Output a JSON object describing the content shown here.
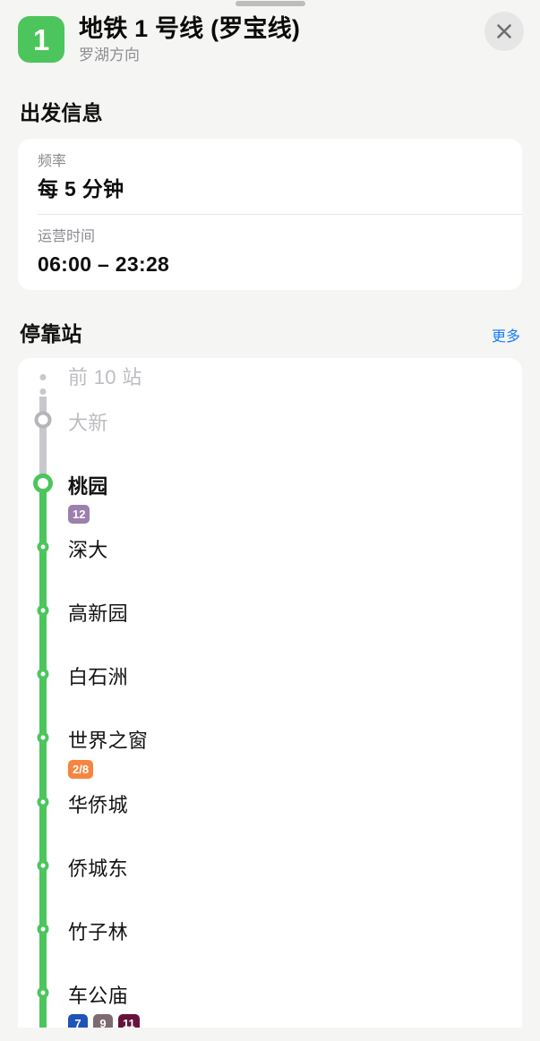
{
  "window": {
    "grabber": "drag-handle"
  },
  "header": {
    "line_number": "1",
    "line_color": "#4cc65c",
    "title": "地铁 1 号线 (罗宝线)",
    "direction": "罗湖方向",
    "close_label": "关闭"
  },
  "departure_section": {
    "title": "出发信息",
    "rows": [
      {
        "label": "频率",
        "value": "每 5 分钟"
      },
      {
        "label": "运营时间",
        "value": "06:00 – 23:28"
      }
    ]
  },
  "stops_section": {
    "title": "停靠站",
    "more_label": "更多",
    "collapsed_label": "前 10 站",
    "stops": [
      {
        "name": "大新",
        "state": "past",
        "node": "gray-big",
        "bold": false,
        "badges": []
      },
      {
        "name": "桃园",
        "state": "current",
        "node": "green-big",
        "bold": true,
        "badges": [
          {
            "label": "12",
            "color": "#9c7fae"
          }
        ]
      },
      {
        "name": "深大",
        "state": "upcoming",
        "node": "green-small",
        "bold": false,
        "badges": []
      },
      {
        "name": "高新园",
        "state": "upcoming",
        "node": "green-small",
        "bold": false,
        "badges": []
      },
      {
        "name": "白石洲",
        "state": "upcoming",
        "node": "green-small",
        "bold": false,
        "badges": []
      },
      {
        "name": "世界之窗",
        "state": "upcoming",
        "node": "green-small",
        "bold": false,
        "badges": [
          {
            "label": "2/8",
            "color": "#f5853f"
          }
        ]
      },
      {
        "name": "华侨城",
        "state": "upcoming",
        "node": "green-small",
        "bold": false,
        "badges": []
      },
      {
        "name": "侨城东",
        "state": "upcoming",
        "node": "green-small",
        "bold": false,
        "badges": []
      },
      {
        "name": "竹子林",
        "state": "upcoming",
        "node": "green-small",
        "bold": false,
        "badges": []
      },
      {
        "name": "车公庙",
        "state": "upcoming",
        "node": "green-small",
        "bold": false,
        "badges": [
          {
            "label": "7",
            "color": "#1e53b8"
          },
          {
            "label": "9",
            "color": "#7e6a70"
          },
          {
            "label": "11",
            "color": "#66133c"
          }
        ]
      }
    ]
  },
  "colors": {
    "background": "#f5f5f3",
    "card": "#ffffff",
    "line_green": "#4cc65c",
    "rail_gray": "#c7c7cc",
    "link_blue": "#1a7cff",
    "muted_text": "#bdbdc2"
  }
}
